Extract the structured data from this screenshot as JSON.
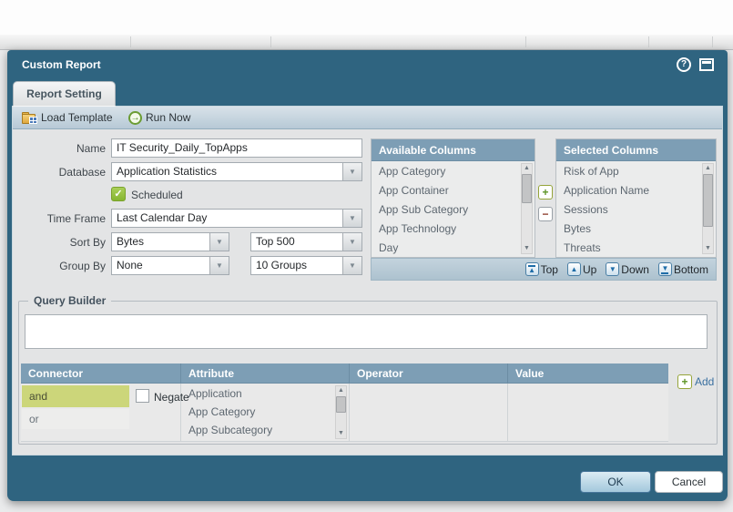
{
  "window": {
    "title": "Custom Report"
  },
  "tabs": {
    "report_setting": "Report Setting"
  },
  "toolbar": {
    "load_template": "Load Template",
    "run_now": "Run Now"
  },
  "form": {
    "name": {
      "label": "Name",
      "value": "IT Security_Daily_TopApps"
    },
    "database": {
      "label": "Database",
      "value": "Application Statistics"
    },
    "scheduled": {
      "label": "Scheduled",
      "checked": true,
      "check_glyph": "✓"
    },
    "time_frame": {
      "label": "Time Frame",
      "value": "Last Calendar Day"
    },
    "sort_by": {
      "label": "Sort By",
      "value": "Bytes",
      "top_value": "Top 500"
    },
    "group_by": {
      "label": "Group By",
      "value": "None",
      "groups_value": "10 Groups"
    }
  },
  "available_columns": {
    "header": "Available Columns",
    "items": [
      "App Category",
      "App Container",
      "App Sub Category",
      "App Technology",
      "Day"
    ]
  },
  "selected_columns": {
    "header": "Selected Columns",
    "items": [
      "Risk of App",
      "Application Name",
      "Sessions",
      "Bytes",
      "Threats"
    ]
  },
  "move_buttons": {
    "top": "Top",
    "up": "Up",
    "down": "Down",
    "bottom": "Bottom"
  },
  "query_builder": {
    "legend": "Query Builder",
    "query_text": "",
    "table": {
      "headers": {
        "connector": "Connector",
        "attribute": "Attribute",
        "operator": "Operator",
        "value": "Value"
      },
      "connector_options": [
        "and",
        "or"
      ],
      "selected_connector": "and",
      "negate_label": "Negate",
      "attribute_options": [
        "Application",
        "App Category",
        "App Subcategory"
      ]
    },
    "add_label": "Add"
  },
  "footer": {
    "ok": "OK",
    "cancel": "Cancel"
  },
  "icons": {
    "help": "?",
    "plus": "+",
    "minus": "−",
    "up_arrow": "▲",
    "down_arrow": "▼",
    "run_arrow": "→"
  },
  "colors": {
    "titlebar": "#2f6480",
    "panel_header": "#7d9eb5",
    "highlight_row": "#ccd67a",
    "scheduled_green": "#8cbf3f",
    "ok_button": "#a3c8dc",
    "content_bg": "#e3e4e5"
  }
}
